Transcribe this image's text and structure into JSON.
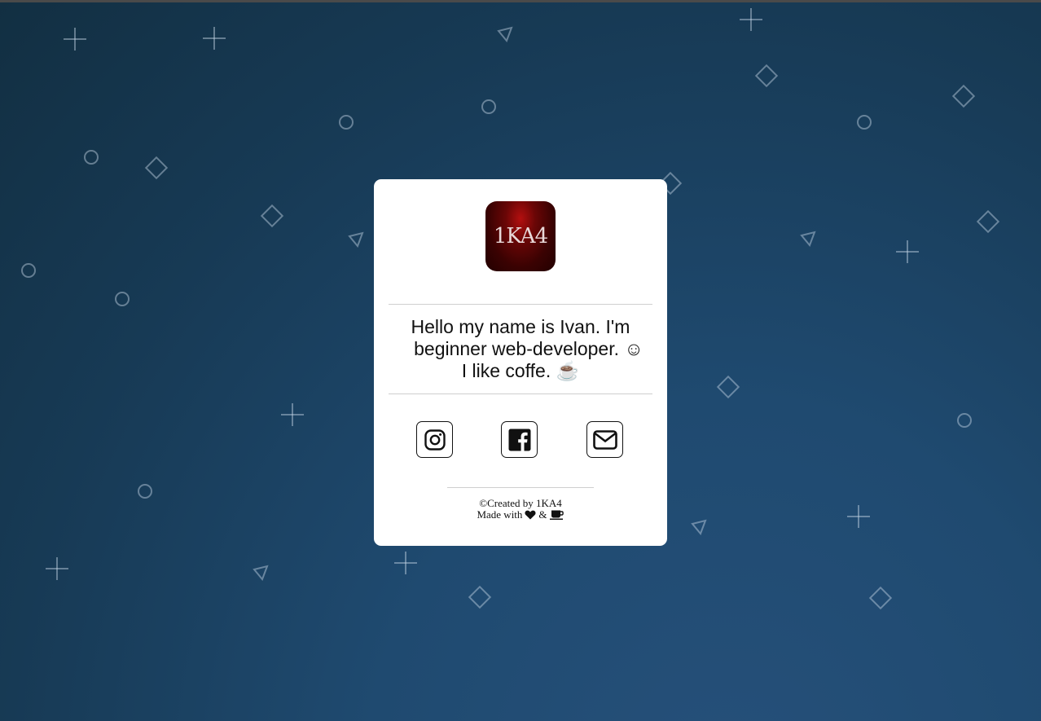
{
  "profile": {
    "logo_text": "1KA4",
    "bio_lines": [
      "Hello my name is Ivan. I'm",
      "beginner web-developer. ☺",
      "I like coffe. ☕"
    ]
  },
  "social": [
    {
      "name": "instagram",
      "icon": "instagram-icon"
    },
    {
      "name": "facebook",
      "icon": "facebook-icon"
    },
    {
      "name": "email",
      "icon": "mail-icon"
    }
  ],
  "footer": {
    "created": "©Created by 1KA4",
    "made_with": "Made with",
    "and": "&",
    "icons": [
      "heart-icon",
      "coffee-cup-icon"
    ]
  },
  "theme": {
    "background_top": "#122f42",
    "background_bottom": "#26507a",
    "card": "#ffffff",
    "logo_red": "#b30f0f"
  }
}
